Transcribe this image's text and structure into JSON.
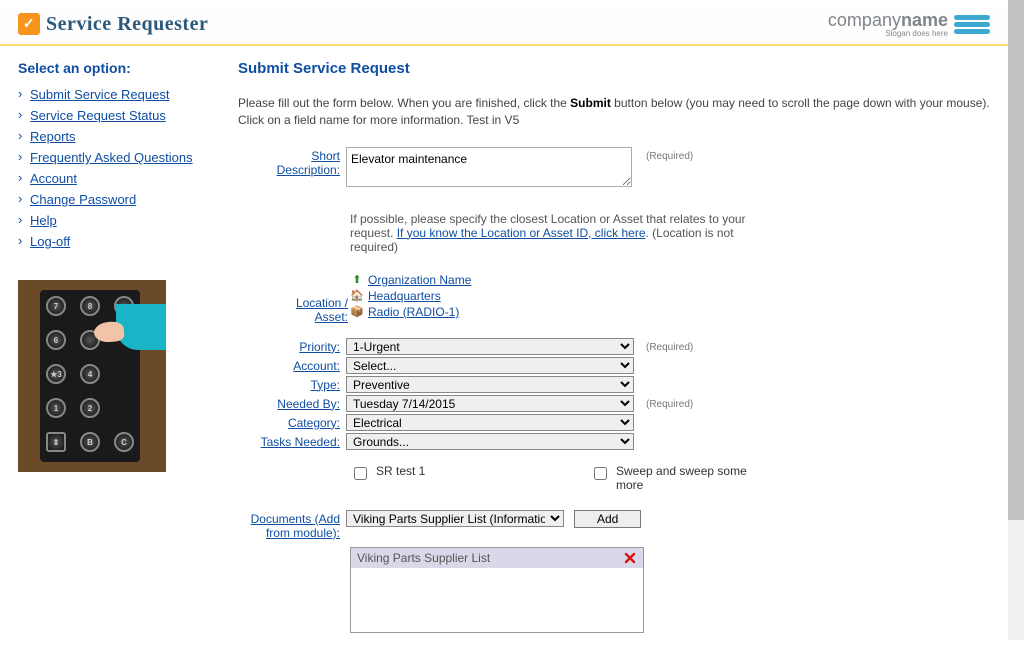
{
  "header": {
    "app_name": "Service Requester",
    "company_main": "company",
    "company_bold": "name",
    "company_slogan": "Slogan does here"
  },
  "sidebar": {
    "heading": "Select an option:",
    "items": [
      {
        "label": "Submit Service Request"
      },
      {
        "label": "Service Request Status"
      },
      {
        "label": "Reports"
      },
      {
        "label": "Frequently Asked Questions"
      },
      {
        "label": "Account"
      },
      {
        "label": "Change Password"
      },
      {
        "label": "Help"
      },
      {
        "label": "Log-off"
      }
    ]
  },
  "main": {
    "title": "Submit Service Request",
    "instructions_pre": "Please fill out the form below. When you are finished, click the ",
    "instructions_bold": "Submit",
    "instructions_post": " button below (you may need to scroll the page down with your mouse). Click on a field name for more information. Test in V5",
    "labels": {
      "short_desc1": "Short",
      "short_desc2": "Description:",
      "location1": "Location /",
      "location2": "Asset:",
      "priority": "Priority:",
      "account": "Account:",
      "type": "Type:",
      "needed_by": "Needed By:",
      "category": "Category:",
      "tasks_needed": "Tasks Needed:",
      "documents1": "Documents (Add",
      "documents2": "from module):"
    },
    "required_text": "(Required)",
    "short_desc_value": "Elevator maintenance",
    "location_hint_pre": "If possible, please specify the closest Location or Asset that relates to your request. ",
    "location_hint_link": "If you know the Location or Asset ID, click here",
    "location_hint_post": ". (Location is not required)",
    "location_tree": {
      "org": "Organization Name",
      "building": "Headquarters",
      "asset": "Radio (RADIO-1)"
    },
    "fields": {
      "priority": "1-Urgent",
      "account": "Select...",
      "type": "Preventive",
      "needed_by": "Tuesday 7/14/2015",
      "category": "Electrical",
      "tasks_needed": "Grounds..."
    },
    "checkboxes": {
      "cb1": "SR test 1",
      "cb2": "Sweep and sweep some more"
    },
    "documents": {
      "select_value": "Viking Parts Supplier List (Informational Docum",
      "add_btn": "Add",
      "attached": "Viking Parts Supplier List"
    }
  }
}
